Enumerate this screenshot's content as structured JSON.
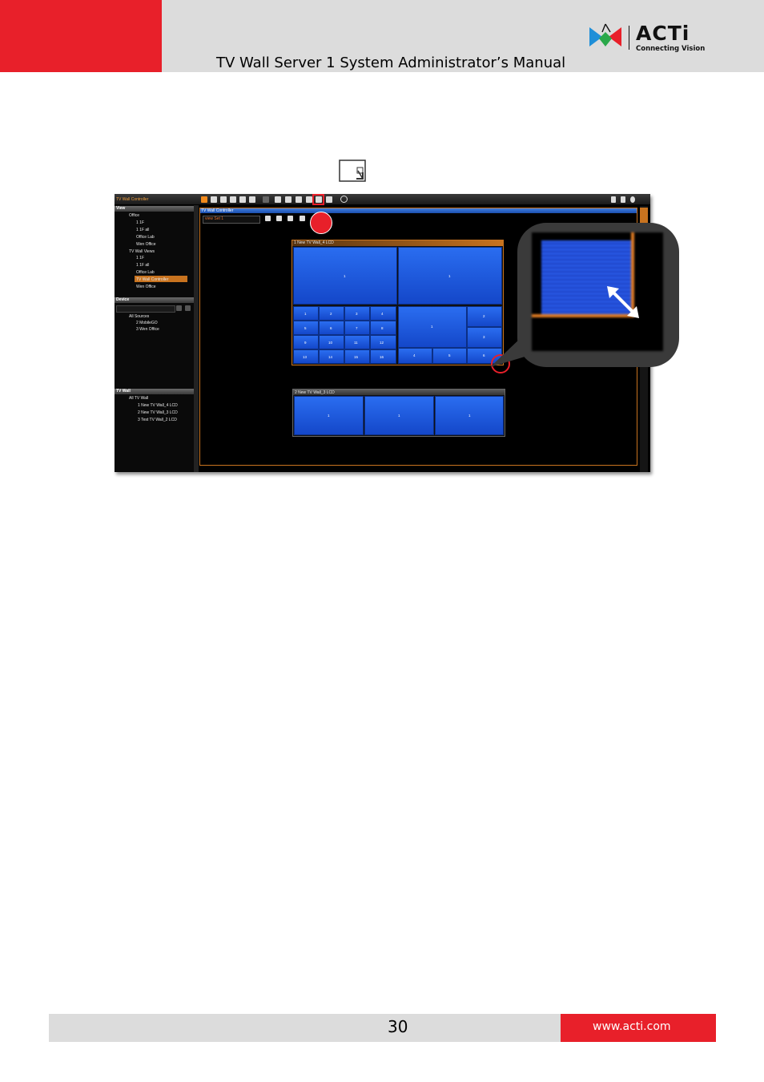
{
  "header": {
    "title": "TV Wall Server 1 System Administrator’s Manual",
    "logo_brand": "ACTi",
    "logo_tagline": "Connecting Vision",
    "colors": {
      "accent_red": "#e8202a",
      "band_gray": "#dcdcdc"
    }
  },
  "inline_icon": "resize-window-icon",
  "screenshot": {
    "app_title": "TV Wall Controller",
    "tree_view": {
      "heading": "View",
      "items": [
        "Office",
        "1 1F",
        "1 1F all",
        "Office Lab",
        "Wen Office",
        "TV Wall Views",
        "1 1F",
        "1 1F all",
        "Office Lab",
        "TV Wall Controller",
        "Wen Office"
      ]
    },
    "tree_device": {
      "heading": "Device",
      "items": [
        "All Sources",
        "2 MobileGO",
        "3 Wen Office"
      ]
    },
    "tree_tvwall": {
      "heading": "TV Wall",
      "items": [
        "All TV Wall",
        "1 New TV Wall_4 LCD",
        "2 New TV Wall_3 LCD",
        "3 Test TV Wall_2 LCD"
      ]
    },
    "main_title": "TV Wall Controller",
    "view_select": "view Set 1",
    "wall1": {
      "title": "1 New TV Wall_4 LCD",
      "top_left": "1",
      "top_right": "1",
      "grid": [
        "1",
        "2",
        "3",
        "4",
        "5",
        "6",
        "7",
        "8",
        "9",
        "10",
        "11",
        "12",
        "13",
        "14",
        "15",
        "16"
      ],
      "br_big": "1",
      "br_cells": [
        "2",
        "3",
        "4",
        "5",
        "6"
      ]
    },
    "wall2": {
      "title": "2 New TV Wall_3 LCD",
      "cells": [
        "1",
        "1",
        "1"
      ]
    }
  },
  "footer": {
    "page_number": "30",
    "website": "www.acti.com"
  }
}
